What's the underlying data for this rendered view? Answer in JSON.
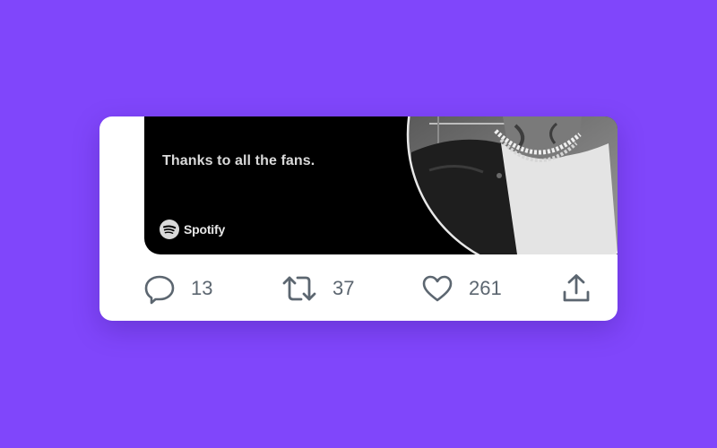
{
  "tweet": {
    "media": {
      "caption": "Thanks to all the fans.",
      "brand": {
        "name": "Spotify",
        "icon": "spotify-logo-icon"
      },
      "photo": "artist-portrait-photo"
    },
    "actions": {
      "reply": {
        "icon": "reply-icon",
        "count": "13"
      },
      "retweet": {
        "icon": "retweet-icon",
        "count": "37"
      },
      "like": {
        "icon": "heart-icon",
        "count": "261"
      },
      "share": {
        "icon": "share-icon"
      }
    }
  },
  "colors": {
    "background": "#8046fb",
    "card": "#ffffff",
    "media": "#000000",
    "action_gray": "#5c6670"
  }
}
